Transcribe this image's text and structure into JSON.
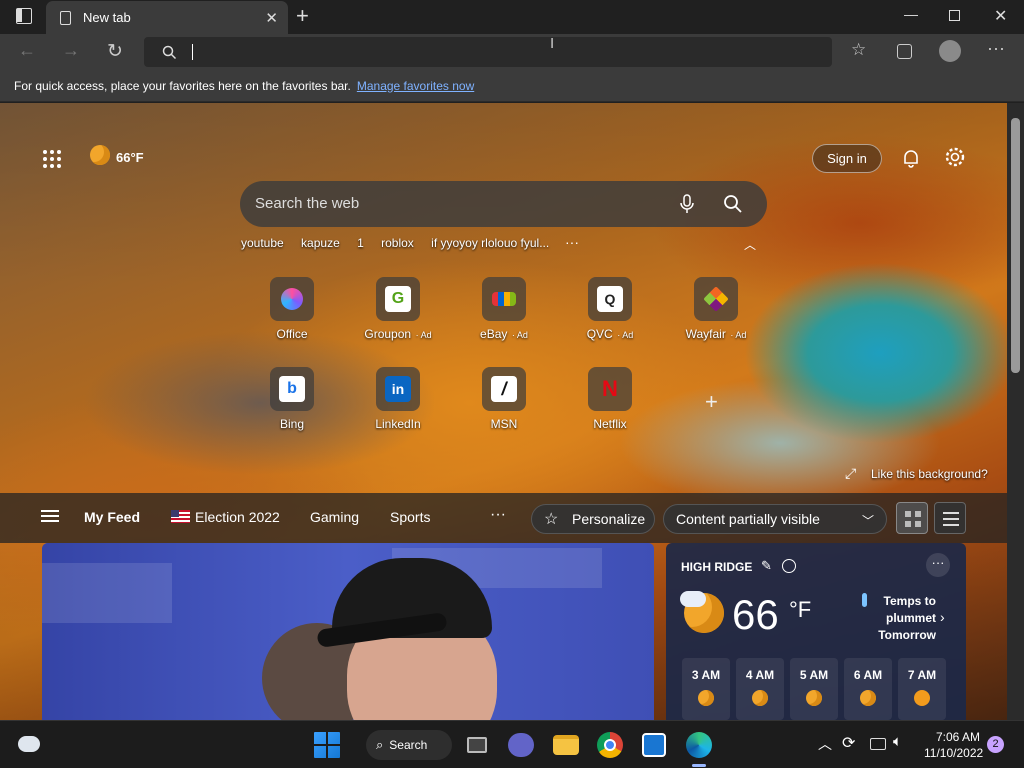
{
  "browser": {
    "tab_title": "New tab",
    "favbar_message": "For quick access, place your favorites here on the favorites bar.",
    "favbar_link": "Manage favorites now"
  },
  "header": {
    "weather_temp": "66°F",
    "sign_in": "Sign in"
  },
  "search": {
    "placeholder": "Search the web",
    "trending": [
      "youtube",
      "kapuze",
      "1",
      "roblox",
      "if yyoyoy rlolouo fyul..."
    ]
  },
  "tiles": [
    {
      "label": "Office",
      "ad": "",
      "glyph": "",
      "color": "#7b5cff"
    },
    {
      "label": "Groupon",
      "ad": "Ad",
      "glyph": "G",
      "color": "#53a318"
    },
    {
      "label": "eBay",
      "ad": "Ad",
      "glyph": "",
      "color": "#e53238"
    },
    {
      "label": "QVC",
      "ad": "Ad",
      "glyph": "Q",
      "color": "#ffffff"
    },
    {
      "label": "Wayfair",
      "ad": "Ad",
      "glyph": "",
      "color": "#7f187f"
    },
    {
      "label": "Bing",
      "ad": "",
      "glyph": "b",
      "color": "#ffffff"
    },
    {
      "label": "LinkedIn",
      "ad": "",
      "glyph": "in",
      "color": "#0a66c2"
    },
    {
      "label": "MSN",
      "ad": "",
      "glyph": "/",
      "color": "#ffffff"
    },
    {
      "label": "Netflix",
      "ad": "",
      "glyph": "N",
      "color": "#e50914"
    }
  ],
  "background": {
    "prompt": "Like this background?"
  },
  "feed": {
    "my_feed": "My Feed",
    "tabs": [
      "Election 2022",
      "Gaming",
      "Sports"
    ],
    "personalize": "Personalize",
    "content_visibility": "Content partially visible"
  },
  "weather_card": {
    "location": "HIGH RIDGE",
    "temp": "66",
    "unit": "°F",
    "alert": [
      "Temps to",
      "plummet",
      "Tomorrow"
    ],
    "hours": [
      "3 AM",
      "4 AM",
      "5 AM",
      "6 AM",
      "7 AM"
    ]
  },
  "taskbar": {
    "search_label": "Search",
    "time": "7:06 AM",
    "date": "11/10/2022",
    "notification_count": "2"
  }
}
